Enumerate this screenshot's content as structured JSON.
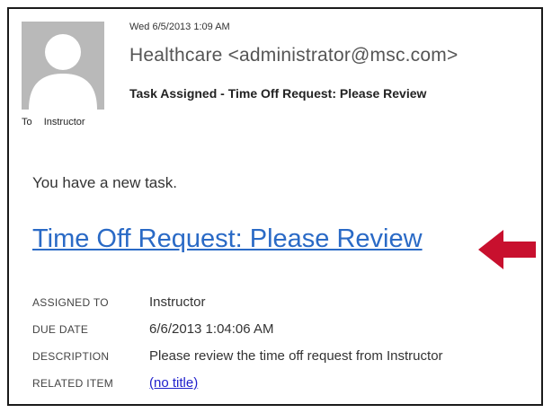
{
  "message": {
    "sent": "Wed 6/5/2013 1:09 AM",
    "sender": "Healthcare <administrator@msc.com>",
    "subject": "Task Assigned - Time Off Request: Please Review",
    "to_label": "To",
    "to_value": "Instructor",
    "avatar_icon": "person-silhouette-icon"
  },
  "body": {
    "intro": "You have a new task.",
    "task_link": "Time Off Request: Please Review",
    "arrow_icon": "left-arrow-icon",
    "arrow_color": "#c8102e",
    "link_color": "#2a6ac6"
  },
  "details": [
    {
      "label": "ASSIGNED TO",
      "value": "Instructor"
    },
    {
      "label": "DUE DATE",
      "value": "6/6/2013 1:04:06 AM"
    },
    {
      "label": "DESCRIPTION",
      "value": "Please review the time off request from Instructor"
    },
    {
      "label": "RELATED ITEM",
      "value": "(no title)"
    }
  ]
}
